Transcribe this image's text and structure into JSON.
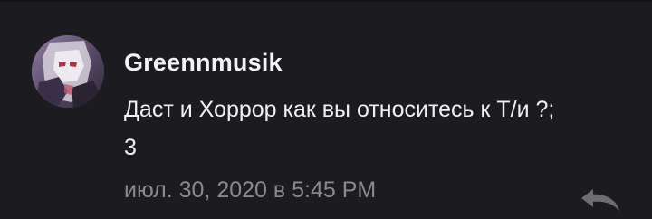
{
  "comment": {
    "author": "Greennmusik",
    "text": "Даст и Хоррор как вы относитесь к Т/и ?;\n3",
    "timestamp": "июл. 30, 2020 в 5:45 PM",
    "avatar_icon": "user-avatar",
    "reply_icon": "reply-arrow-icon"
  },
  "colors": {
    "background": "#1c1b20",
    "text_primary": "#f0f0f2",
    "text_secondary": "#8a8990"
  }
}
